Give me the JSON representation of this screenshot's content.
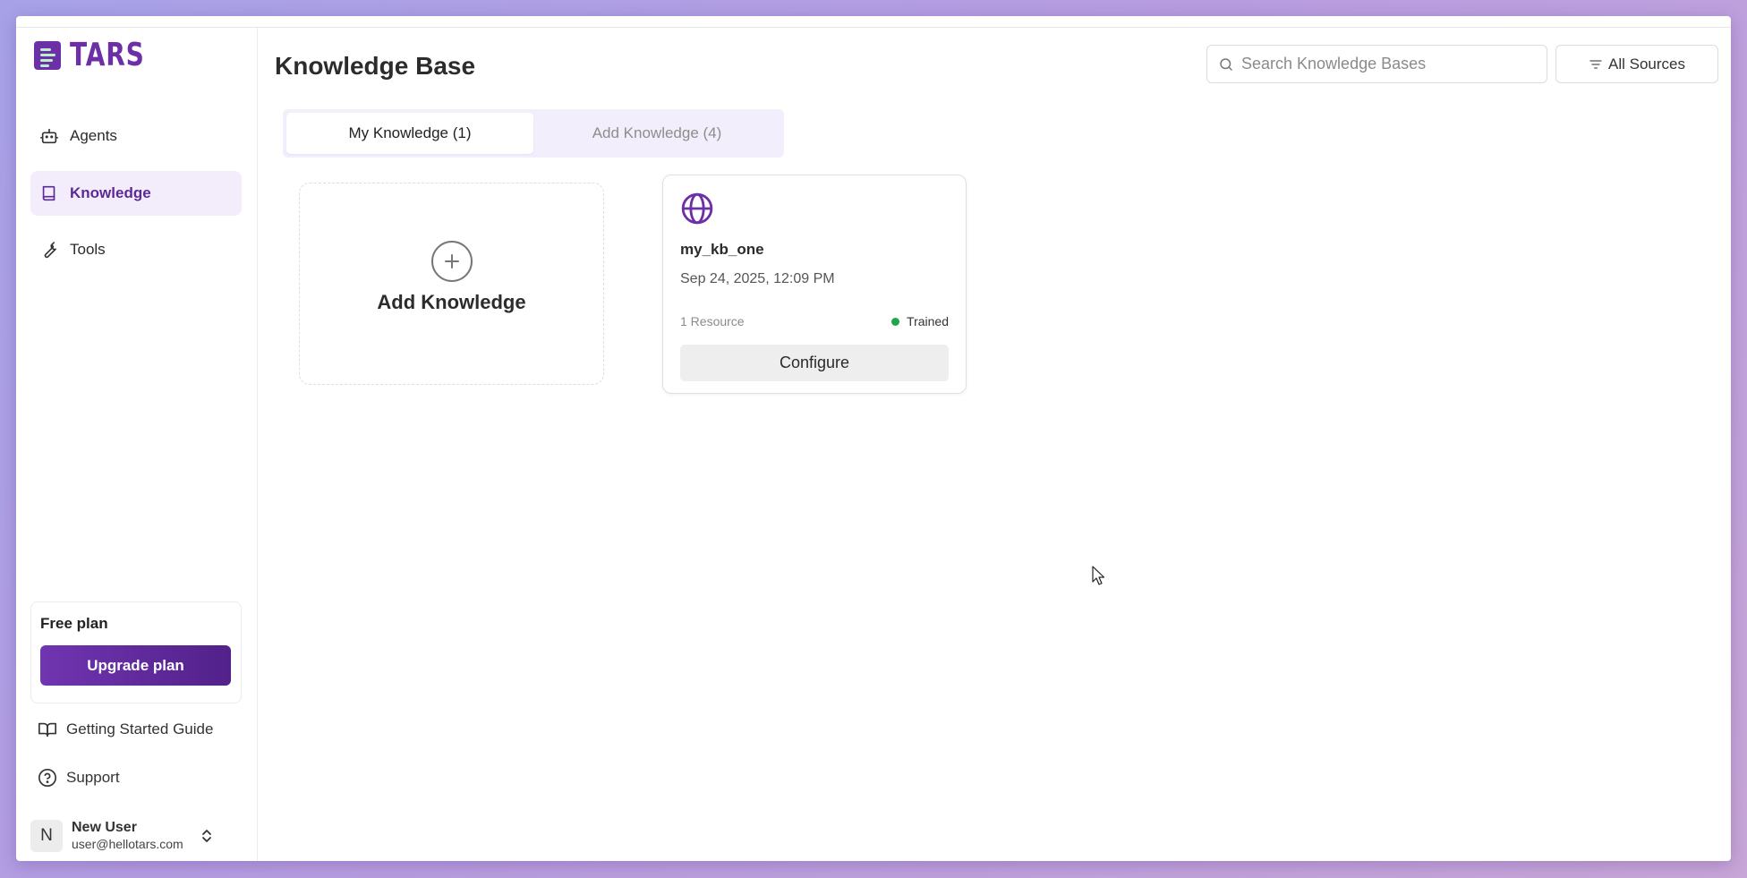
{
  "app": {
    "logo_text": "TARS",
    "brand_color": "#6d2fa7"
  },
  "sidebar": {
    "items": [
      {
        "label": "Agents",
        "icon": "robot-icon",
        "active": false
      },
      {
        "label": "Knowledge",
        "icon": "book-icon",
        "active": true
      },
      {
        "label": "Tools",
        "icon": "wrench-icon",
        "active": false
      }
    ],
    "plan": {
      "title": "Free plan",
      "upgrade_label": "Upgrade plan"
    },
    "links": [
      {
        "label": "Getting Started Guide",
        "icon": "open-book-icon"
      },
      {
        "label": "Support",
        "icon": "help-circle-icon"
      }
    ],
    "user": {
      "initial": "N",
      "name": "New User",
      "email": "user@hellotars.com"
    }
  },
  "header": {
    "title": "Knowledge Base",
    "search_placeholder": "Search Knowledge Bases",
    "filter_label": "All Sources"
  },
  "tabs": [
    {
      "label": "My Knowledge (1)",
      "active": true
    },
    {
      "label": "Add Knowledge (4)",
      "active": false
    }
  ],
  "add_card": {
    "label": "Add Knowledge"
  },
  "kb_cards": [
    {
      "icon": "globe-icon",
      "name": "my_kb_one",
      "date": "Sep 24, 2025, 12:09 PM",
      "resources": "1 Resource",
      "status": "Trained",
      "status_color": "#1fa64a",
      "action_label": "Configure"
    }
  ]
}
